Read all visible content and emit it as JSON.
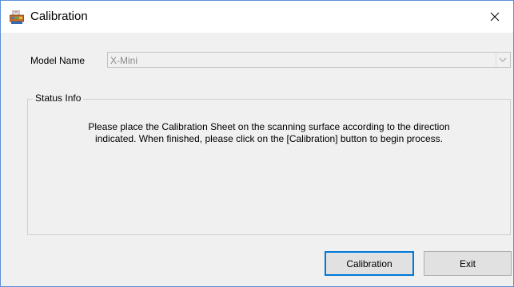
{
  "window": {
    "title": "Calibration",
    "close_glyph": "✕",
    "icon": "scanner-app-icon"
  },
  "model": {
    "label": "Model Name",
    "selected": "X-Mini",
    "disabled": true
  },
  "status": {
    "group_label": "Status Info",
    "message_line1": "Please place the Calibration Sheet on the scanning surface according to the direction",
    "message_line2": "indicated. When finished, please click on the [Calibration] button to begin process."
  },
  "buttons": {
    "calibration": "Calibration",
    "exit": "Exit"
  },
  "colors": {
    "accent": "#0078d7",
    "window_border": "#5a8fd8",
    "dialog_bg": "#f0f0f0",
    "disabled_text": "#8a8a8a"
  }
}
